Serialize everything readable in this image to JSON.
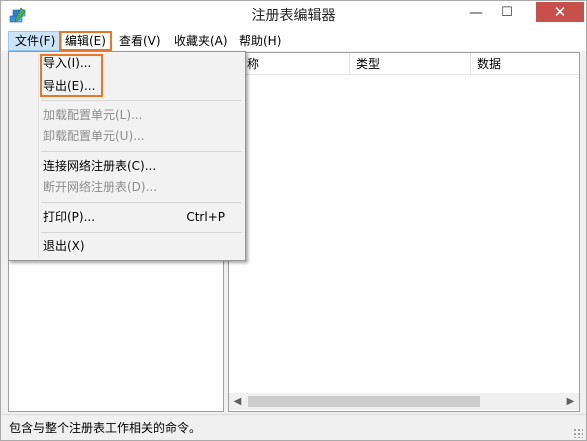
{
  "window": {
    "title": "注册表编辑器",
    "min_glyph": "—",
    "max_glyph": "☐",
    "close_glyph": "✕"
  },
  "menubar": {
    "file": "文件(F)",
    "edit": "编辑(E)",
    "view": "查看(V)",
    "favorites": "收藏夹(A)",
    "help": "帮助(H)"
  },
  "file_menu": {
    "import": "导入(I)...",
    "export": "导出(E)...",
    "load_hive": "加载配置单元(L)...",
    "unload_hive": "卸载配置单元(U)...",
    "connect_network": "连接网络注册表(C)...",
    "disconnect_network": "断开网络注册表(D)...",
    "print": "打印(P)...",
    "print_shortcut": "Ctrl+P",
    "exit": "退出(X)"
  },
  "list": {
    "col_name": "名称",
    "col_type": "类型",
    "col_data": "数据"
  },
  "status": {
    "text": "包含与整个注册表工作相关的命令。"
  },
  "colors": {
    "highlight": "#e8772a",
    "close_button": "#c7504c",
    "menu_selected": "#cce4f7"
  }
}
